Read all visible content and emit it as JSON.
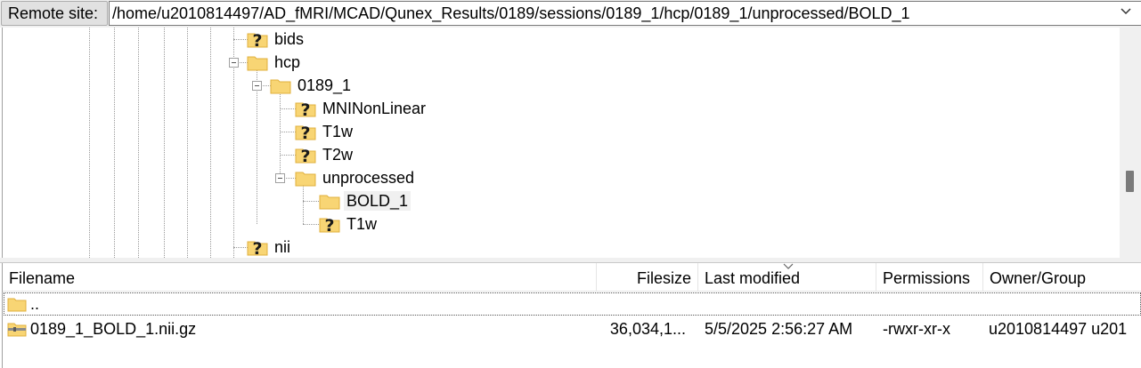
{
  "remote_site": {
    "label": "Remote site:",
    "path": "/home/u2010814497/AD_fMRI/MCAD/Qunex_Results/0189/sessions/0189_1/hcp/0189_1/unprocessed/BOLD_1"
  },
  "tree": {
    "nodes": [
      {
        "label": "bids",
        "icon": "unknown-folder-icon",
        "state": "unread"
      },
      {
        "label": "hcp",
        "icon": "folder-icon",
        "state": "expanded"
      },
      {
        "label": "0189_1",
        "icon": "folder-icon",
        "state": "expanded"
      },
      {
        "label": "MNINonLinear",
        "icon": "unknown-folder-icon",
        "state": "unread"
      },
      {
        "label": "T1w",
        "icon": "unknown-folder-icon",
        "state": "unread"
      },
      {
        "label": "T2w",
        "icon": "unknown-folder-icon",
        "state": "unread"
      },
      {
        "label": "unprocessed",
        "icon": "folder-icon",
        "state": "expanded"
      },
      {
        "label": "BOLD_1",
        "icon": "folder-icon",
        "state": "selected"
      },
      {
        "label": "T1w",
        "icon": "unknown-folder-icon",
        "state": "unread"
      },
      {
        "label": "nii",
        "icon": "unknown-folder-icon",
        "state": "unread"
      }
    ]
  },
  "file_list": {
    "columns": {
      "filename": "Filename",
      "filesize": "Filesize",
      "last_modified": "Last modified",
      "permissions": "Permissions",
      "owner_group": "Owner/Group"
    },
    "sorted_by": "Last modified",
    "rows": [
      {
        "filename": "..",
        "icon": "folder-icon",
        "filesize": "",
        "last_modified": "",
        "permissions": "",
        "owner_group": ""
      },
      {
        "filename": "0189_1_BOLD_1.nii.gz",
        "icon": "archive-file-icon",
        "filesize": "36,034,1...",
        "last_modified": "5/5/2025 2:56:27 AM",
        "permissions": "-rwxr-xr-x",
        "owner_group": "u2010814497 u201"
      }
    ]
  },
  "colors": {
    "folder": "#f8d574",
    "folder_edge": "#e0b03c",
    "question_mark": "#1a1a1a",
    "selection": "#f0f0f0"
  }
}
